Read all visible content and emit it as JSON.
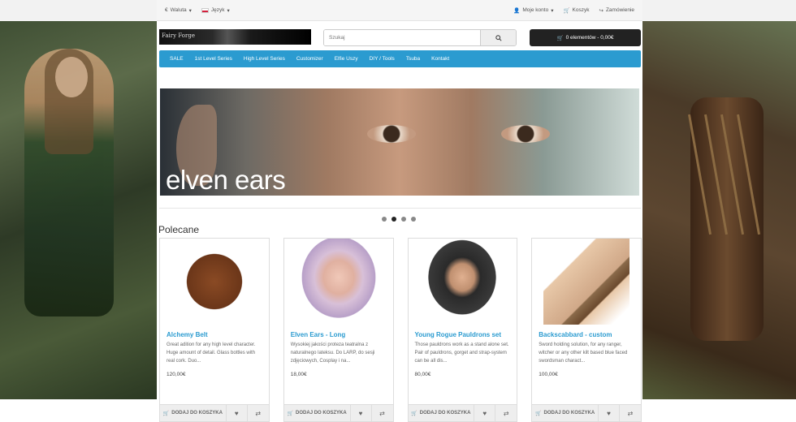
{
  "topbar": {
    "currency_label": "Waluta",
    "language_label": "Język",
    "account_label": "Moje konto",
    "cart_label": "Koszyk",
    "checkout_label": "Zamówienie"
  },
  "header": {
    "logo_text": "Fairy Forge",
    "search_placeholder": "Szukaj",
    "cart_button": "0 elementów - 0,00€"
  },
  "nav": {
    "items": [
      {
        "label": "SALE"
      },
      {
        "label": "1st Level Series"
      },
      {
        "label": "High Level Series"
      },
      {
        "label": "Customizer"
      },
      {
        "label": "Elfie Uszy"
      },
      {
        "label": "DIY / Tools"
      },
      {
        "label": "Tsuba"
      },
      {
        "label": "Kontakt"
      }
    ]
  },
  "banner": {
    "caption": "elven ears",
    "slides": 4,
    "active_slide": 2
  },
  "featured": {
    "title": "Polecane",
    "add_to_cart_label": "DODAJ DO KOSZYKA",
    "products": [
      {
        "name": "Alchemy Belt",
        "desc": "Great adition for any high level character. Huge amount of detail. Glass bottles with real cork. Duo...",
        "price": "120,00€"
      },
      {
        "name": "Elven Ears - Long",
        "desc": "Wysokiej jakości proteza teatralna z naturalnego lateksu. Do LARP, do sesji zdjęciowych, Cosplay i na...",
        "price": "18,00€"
      },
      {
        "name": "Young Rogue Pauldrons set",
        "desc": "Those pauldrons work as a stand alone set. Pair of pauldrons, gorget and strap-system can be all dis...",
        "price": "80,00€"
      },
      {
        "name": "Backscabbard - custom",
        "desc": "Sword holding solution, for any ranger, witcher or any other kilt based blue faced swordsman charact...",
        "price": "100,00€"
      }
    ]
  }
}
